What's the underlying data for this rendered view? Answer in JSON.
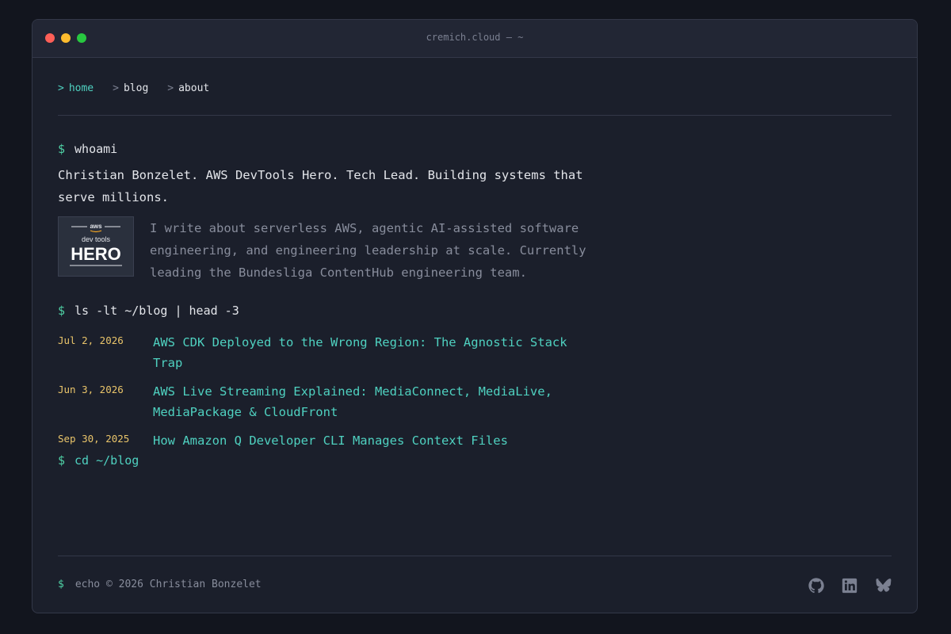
{
  "window": {
    "title": "cremich.cloud — ~"
  },
  "nav": {
    "items": [
      {
        "caret": ">",
        "label": "home"
      },
      {
        "caret": ">",
        "label": "blog"
      },
      {
        "caret": ">",
        "label": "about"
      }
    ]
  },
  "whoami": {
    "prompt": "$",
    "command": "whoami",
    "intro": "Christian Bonzelet. AWS DevTools Hero. Tech Lead. Building systems that serve millions.",
    "bio": "I write about serverless AWS, agentic AI-assisted software engineering, and engineering leadership at scale. Currently leading the Bundesliga ContentHub engineering team.",
    "badge": {
      "top": "aws",
      "sub": "dev tools",
      "main": "HERO"
    }
  },
  "blog": {
    "prompt": "$",
    "command": "ls -lt ~/blog | head -3",
    "posts": [
      {
        "date": "Jul 2, 2026",
        "title": "AWS CDK Deployed to the Wrong Region: The Agnostic Stack Trap"
      },
      {
        "date": "Jun 3, 2026",
        "title": "AWS Live Streaming Explained: MediaConnect, MediaLive, MediaPackage & CloudFront"
      },
      {
        "date": "Sep 30, 2025",
        "title": "How Amazon Q Developer CLI Manages Context Files"
      }
    ]
  },
  "cd": {
    "prompt": "$",
    "command": "cd ~/blog"
  },
  "footer": {
    "prompt": "$",
    "text": "echo © 2026 Christian Bonzelet",
    "icons": [
      "github-icon",
      "linkedin-icon",
      "bluesky-icon"
    ]
  },
  "colors": {
    "accent": "#4fd1c0",
    "prompt": "#4fd1a5",
    "date": "#e9c46a",
    "background": "#1b1f2b"
  }
}
